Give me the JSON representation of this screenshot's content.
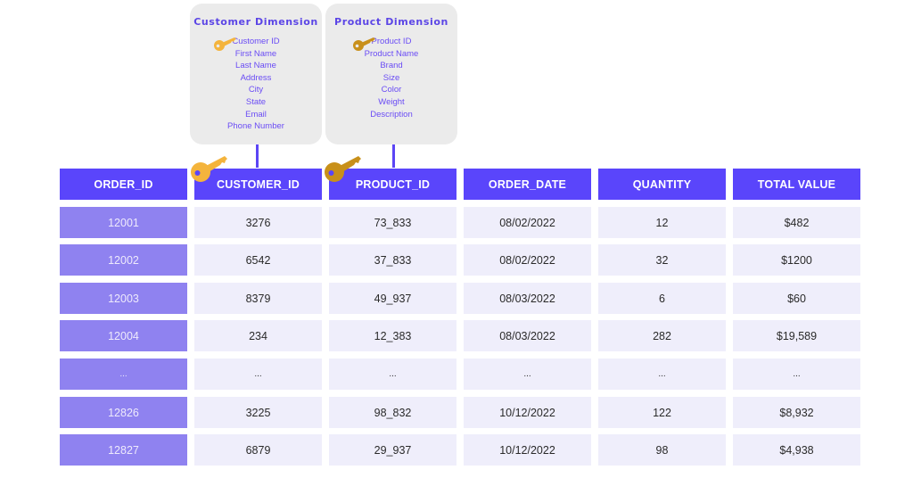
{
  "dimensions": {
    "customer": {
      "title": "Customer Dimension",
      "key_icon": "key-icon",
      "key_color": "#f4b43c",
      "fields": [
        "Customer ID",
        "First Name",
        "Last Name",
        "Address",
        "City",
        "State",
        "Email",
        "Phone Number"
      ]
    },
    "product": {
      "title": "Product Dimension",
      "key_icon": "key-icon",
      "key_color": "#c8901a",
      "fields": [
        "Product ID",
        "Product Name",
        "Brand",
        "Size",
        "Color",
        "Weight",
        "Description"
      ]
    }
  },
  "fact_table": {
    "headers": [
      "ORDER_ID",
      "CUSTOMER_ID",
      "PRODUCT_ID",
      "ORDER_DATE",
      "QUANTITY",
      "TOTAL VALUE"
    ],
    "rows": [
      [
        "12001",
        "3276",
        "73_833",
        "08/02/2022",
        "12",
        "$482"
      ],
      [
        "12002",
        "6542",
        "37_833",
        "08/02/2022",
        "32",
        "$1200"
      ],
      [
        "12003",
        "8379",
        "49_937",
        "08/03/2022",
        "6",
        "$60"
      ],
      [
        "12004",
        "234",
        "12_383",
        "08/03/2022",
        "282",
        "$19,589"
      ],
      [
        "...",
        "...",
        "...",
        "...",
        "...",
        "..."
      ],
      [
        "12826",
        "3225",
        "98_832",
        "10/12/2022",
        "122",
        "$8,932"
      ],
      [
        "12827",
        "6879",
        "29_937",
        "10/12/2022",
        "98",
        "$4,938"
      ]
    ]
  },
  "colors": {
    "header": "#5a45fb",
    "order_id_column": "#8f82f0",
    "body_cell": "#efeefb",
    "dimension_card": "#ebebeb",
    "dimension_text": "#6a4cf5"
  }
}
